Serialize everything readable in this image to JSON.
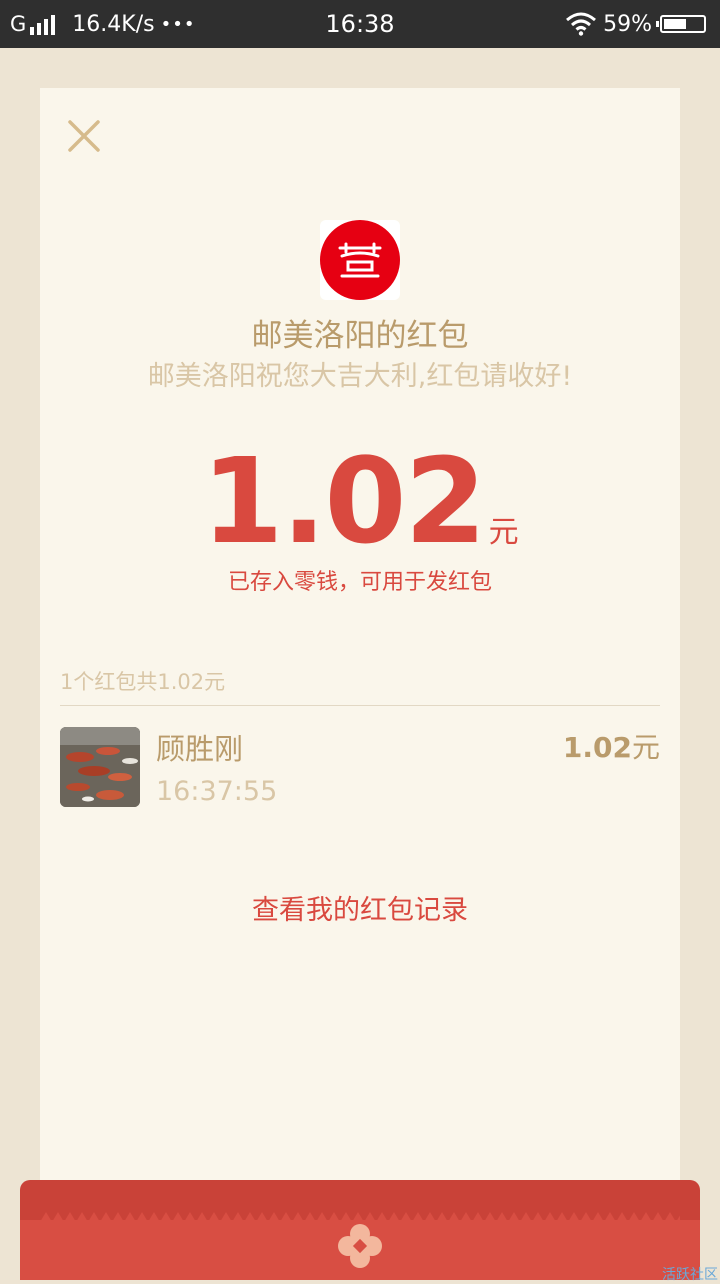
{
  "status_bar": {
    "network": "G",
    "speed": "16.4K/s",
    "dots": "•••",
    "time": "16:38",
    "battery_text": "59%",
    "battery_level": 0.59
  },
  "card": {
    "sender_title": "邮美洛阳的红包",
    "greeting": "邮美洛阳祝您大吉大利,红包请收好!",
    "amount": "1.02",
    "amount_unit": "元",
    "stored_note": "已存入零钱，可用于发红包",
    "summary": "1个红包共1.02元",
    "records": [
      {
        "name": "顾胜刚",
        "time": "16:37:55",
        "amount": "1.02",
        "unit": "元"
      }
    ],
    "history_link": "查看我的红包记录"
  },
  "watermark": "活跃社区",
  "colors": {
    "accent_red": "#d9493f",
    "gold": "#b99b6b",
    "light_gold": "#d9c6a6",
    "card_bg": "#faf6eb",
    "page_bg": "#ede4d3"
  },
  "icons": {
    "close": "close-icon",
    "wifi": "wifi-icon",
    "signal": "signal-icon",
    "battery": "battery-icon",
    "emblem": "envelope-emblem-icon",
    "logo": "sender-logo"
  }
}
